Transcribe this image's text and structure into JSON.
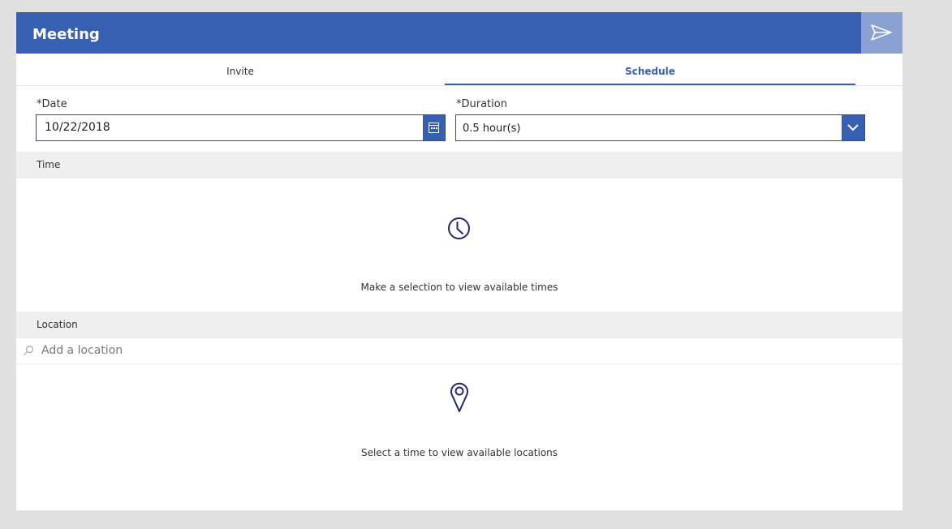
{
  "header": {
    "title": "Meeting",
    "send_icon": "send-icon"
  },
  "tabs": [
    {
      "label": "Invite",
      "active": false
    },
    {
      "label": "Schedule",
      "active": true
    }
  ],
  "form": {
    "date": {
      "label": "*Date",
      "value": "10/22/2018",
      "icon": "calendar-icon"
    },
    "duration": {
      "label": "*Duration",
      "value": "0.5 hour(s)",
      "icon": "chevron-down-icon"
    }
  },
  "time_section": {
    "title": "Time",
    "icon": "clock-icon",
    "empty_message": "Make a selection to view available times"
  },
  "location_section": {
    "title": "Location",
    "search_placeholder": "Add a location",
    "icon": "map-pin-icon",
    "empty_message": "Select a time to view available locations"
  },
  "colors": {
    "accent": "#3860b2",
    "send_button": "#8aa1d3",
    "background": "#e1e1e1",
    "section_header": "#efefef",
    "icon_dark": "#1e2a6b"
  }
}
